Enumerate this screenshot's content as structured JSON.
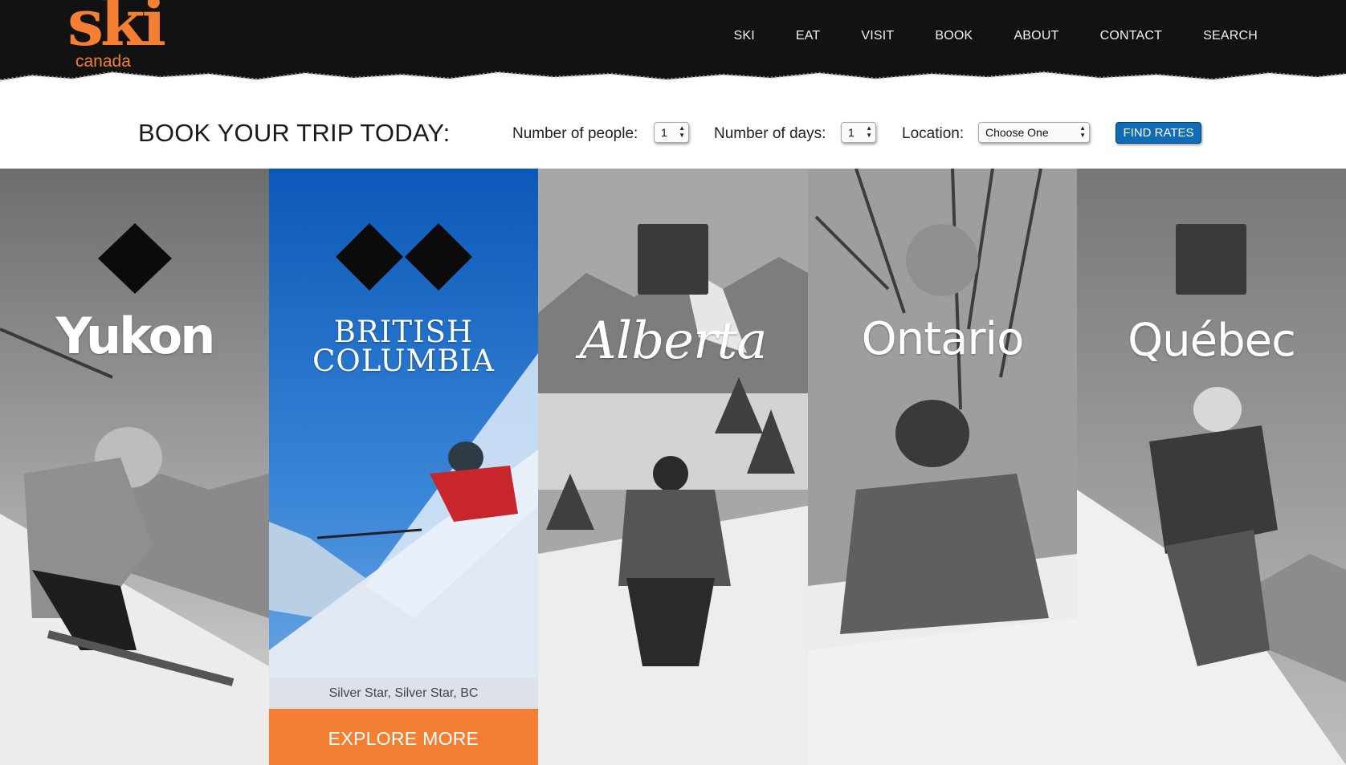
{
  "brand": {
    "logo_main": "ski",
    "logo_sub": "canada",
    "accent": "#f47f32"
  },
  "nav": {
    "items": [
      "SKI",
      "EAT",
      "VISIT",
      "BOOK",
      "ABOUT",
      "CONTACT",
      "SEARCH"
    ]
  },
  "booking": {
    "title": "BOOK YOUR TRIP TODAY:",
    "people_label": "Number of people:",
    "people_value": "1",
    "days_label": "Number of days:",
    "days_value": "1",
    "location_label": "Location:",
    "location_value": "Choose One",
    "button_label": "FIND RATES",
    "button_color": "#0f6db8"
  },
  "regions": [
    {
      "name": "Yukon",
      "difficulty_icon": "black-diamond-icon"
    },
    {
      "name_line1": "BRITISH",
      "name_line2": "COLUMBIA",
      "difficulty_icon": "double-black-diamond-icon",
      "caption": "Silver Star, Silver Star, BC",
      "cta": "EXPLORE MORE"
    },
    {
      "name": "Alberta",
      "difficulty_icon": "dark-square-icon"
    },
    {
      "name": "Ontario",
      "difficulty_icon": "circle-icon"
    },
    {
      "name": "Québec",
      "difficulty_icon": "dark-square-icon"
    }
  ]
}
